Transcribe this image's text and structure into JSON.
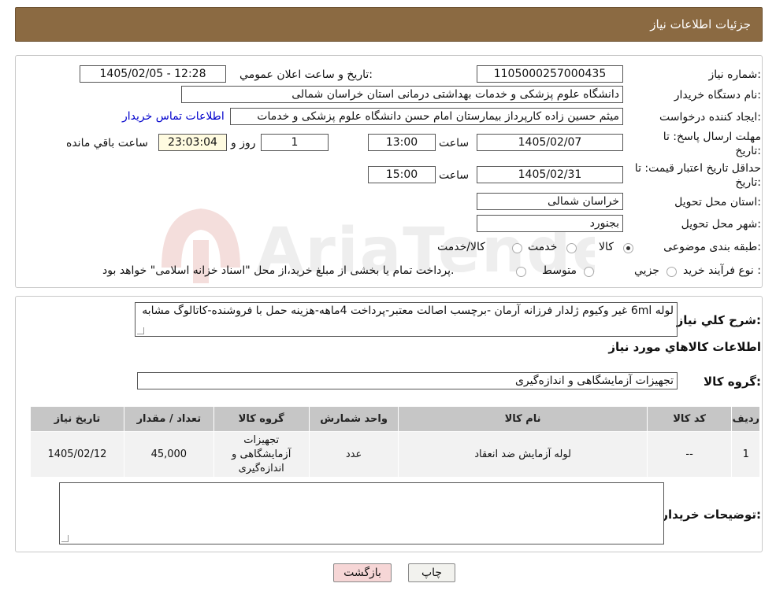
{
  "header": {
    "title": "جزئیات اطلاعات نیاز"
  },
  "form": {
    "need_number_label": "شماره نیاز:",
    "need_number": "1105000257000435",
    "announce_label": "تاریخ و ساعت اعلان عمومي:",
    "announce_value": "1405/02/05 - 12:28",
    "buyer_org_label": "نام دستگاه خريدار:",
    "buyer_org": "دانشگاه علوم پزشکی و خدمات بهداشتی درمانی استان خراسان شمالی",
    "creator_label": "ايجاد کننده درخواست:",
    "creator": "میثم  حسین زاده  کارپرداز بیمارستان امام حسن دانشگاه علوم پزشکی و خدمات",
    "contact_link": "اطلاعات تماس خريدار",
    "deadline_label_1": "مهلت ارسال پاسخ: تا",
    "deadline_label_2": "تاريخ:",
    "deadline_date": "1405/02/07",
    "time_label": "ساعت",
    "deadline_time": "13:00",
    "days_value": "1",
    "days_label": "روز و",
    "remaining_time": "23:03:04",
    "remaining_label": "ساعت باقي مانده",
    "validity_label_1": "حداقل تاريخ اعتبار قيمت: تا",
    "validity_label_2": "تاريخ:",
    "validity_date": "1405/02/31",
    "validity_time": "15:00",
    "province_label": "استان محل تحويل:",
    "province": "خراسان شمالی",
    "city_label": "شهر محل تحويل:",
    "city": "بجنورد",
    "category_label": "طبقه بندی موضوعی:",
    "category_options": [
      "کالا",
      "خدمت",
      "کالا/خدمت"
    ],
    "category_selected": "کالا",
    "process_label": "نوع فرآيند خريد :",
    "process_options": [
      "جزيي",
      "متوسط"
    ],
    "process_note": "پرداخت تمام يا بخشی از مبلغ خريد،از محل \"اسناد خزانه اسلامی\" خواهد بود."
  },
  "summary": {
    "desc_label": "شرح کلي نياز:",
    "desc_text": "لوله 6ml غیر وکیوم ژلدار فرزانه آرمان -برچسب اصالت معتبر-پرداخت 4ماهه-هزینه حمل با فروشنده-کاتالوگ مشابه",
    "goods_info_title": "اطلاعات کالاهاي مورد نياز",
    "group_label": "گروه کالا:",
    "group_value": "تجهیزات آزمایشگاهی و اندازه‌گیری",
    "table": {
      "headers": [
        "رديف",
        "کد کالا",
        "نام کالا",
        "واحد شمارش",
        "گروه کالا",
        "تعداد / مقدار",
        "تاريخ نياز"
      ],
      "rows": [
        [
          "1",
          "--",
          "لوله آزمایش ضد انعقاد",
          "عدد",
          "تجهیزات آزمایشگاهی و اندازه‌گیری",
          "45,000",
          "1405/02/12"
        ]
      ]
    },
    "buyer_notes_label": "توضيحات خريدار:",
    "buyer_notes": ""
  },
  "buttons": {
    "print": "چاپ",
    "back": "بازگشت"
  },
  "colors": {
    "header_bg": "#8b6a42",
    "link": "#0000cc",
    "back_btn_bg": "#f6d6d6"
  }
}
